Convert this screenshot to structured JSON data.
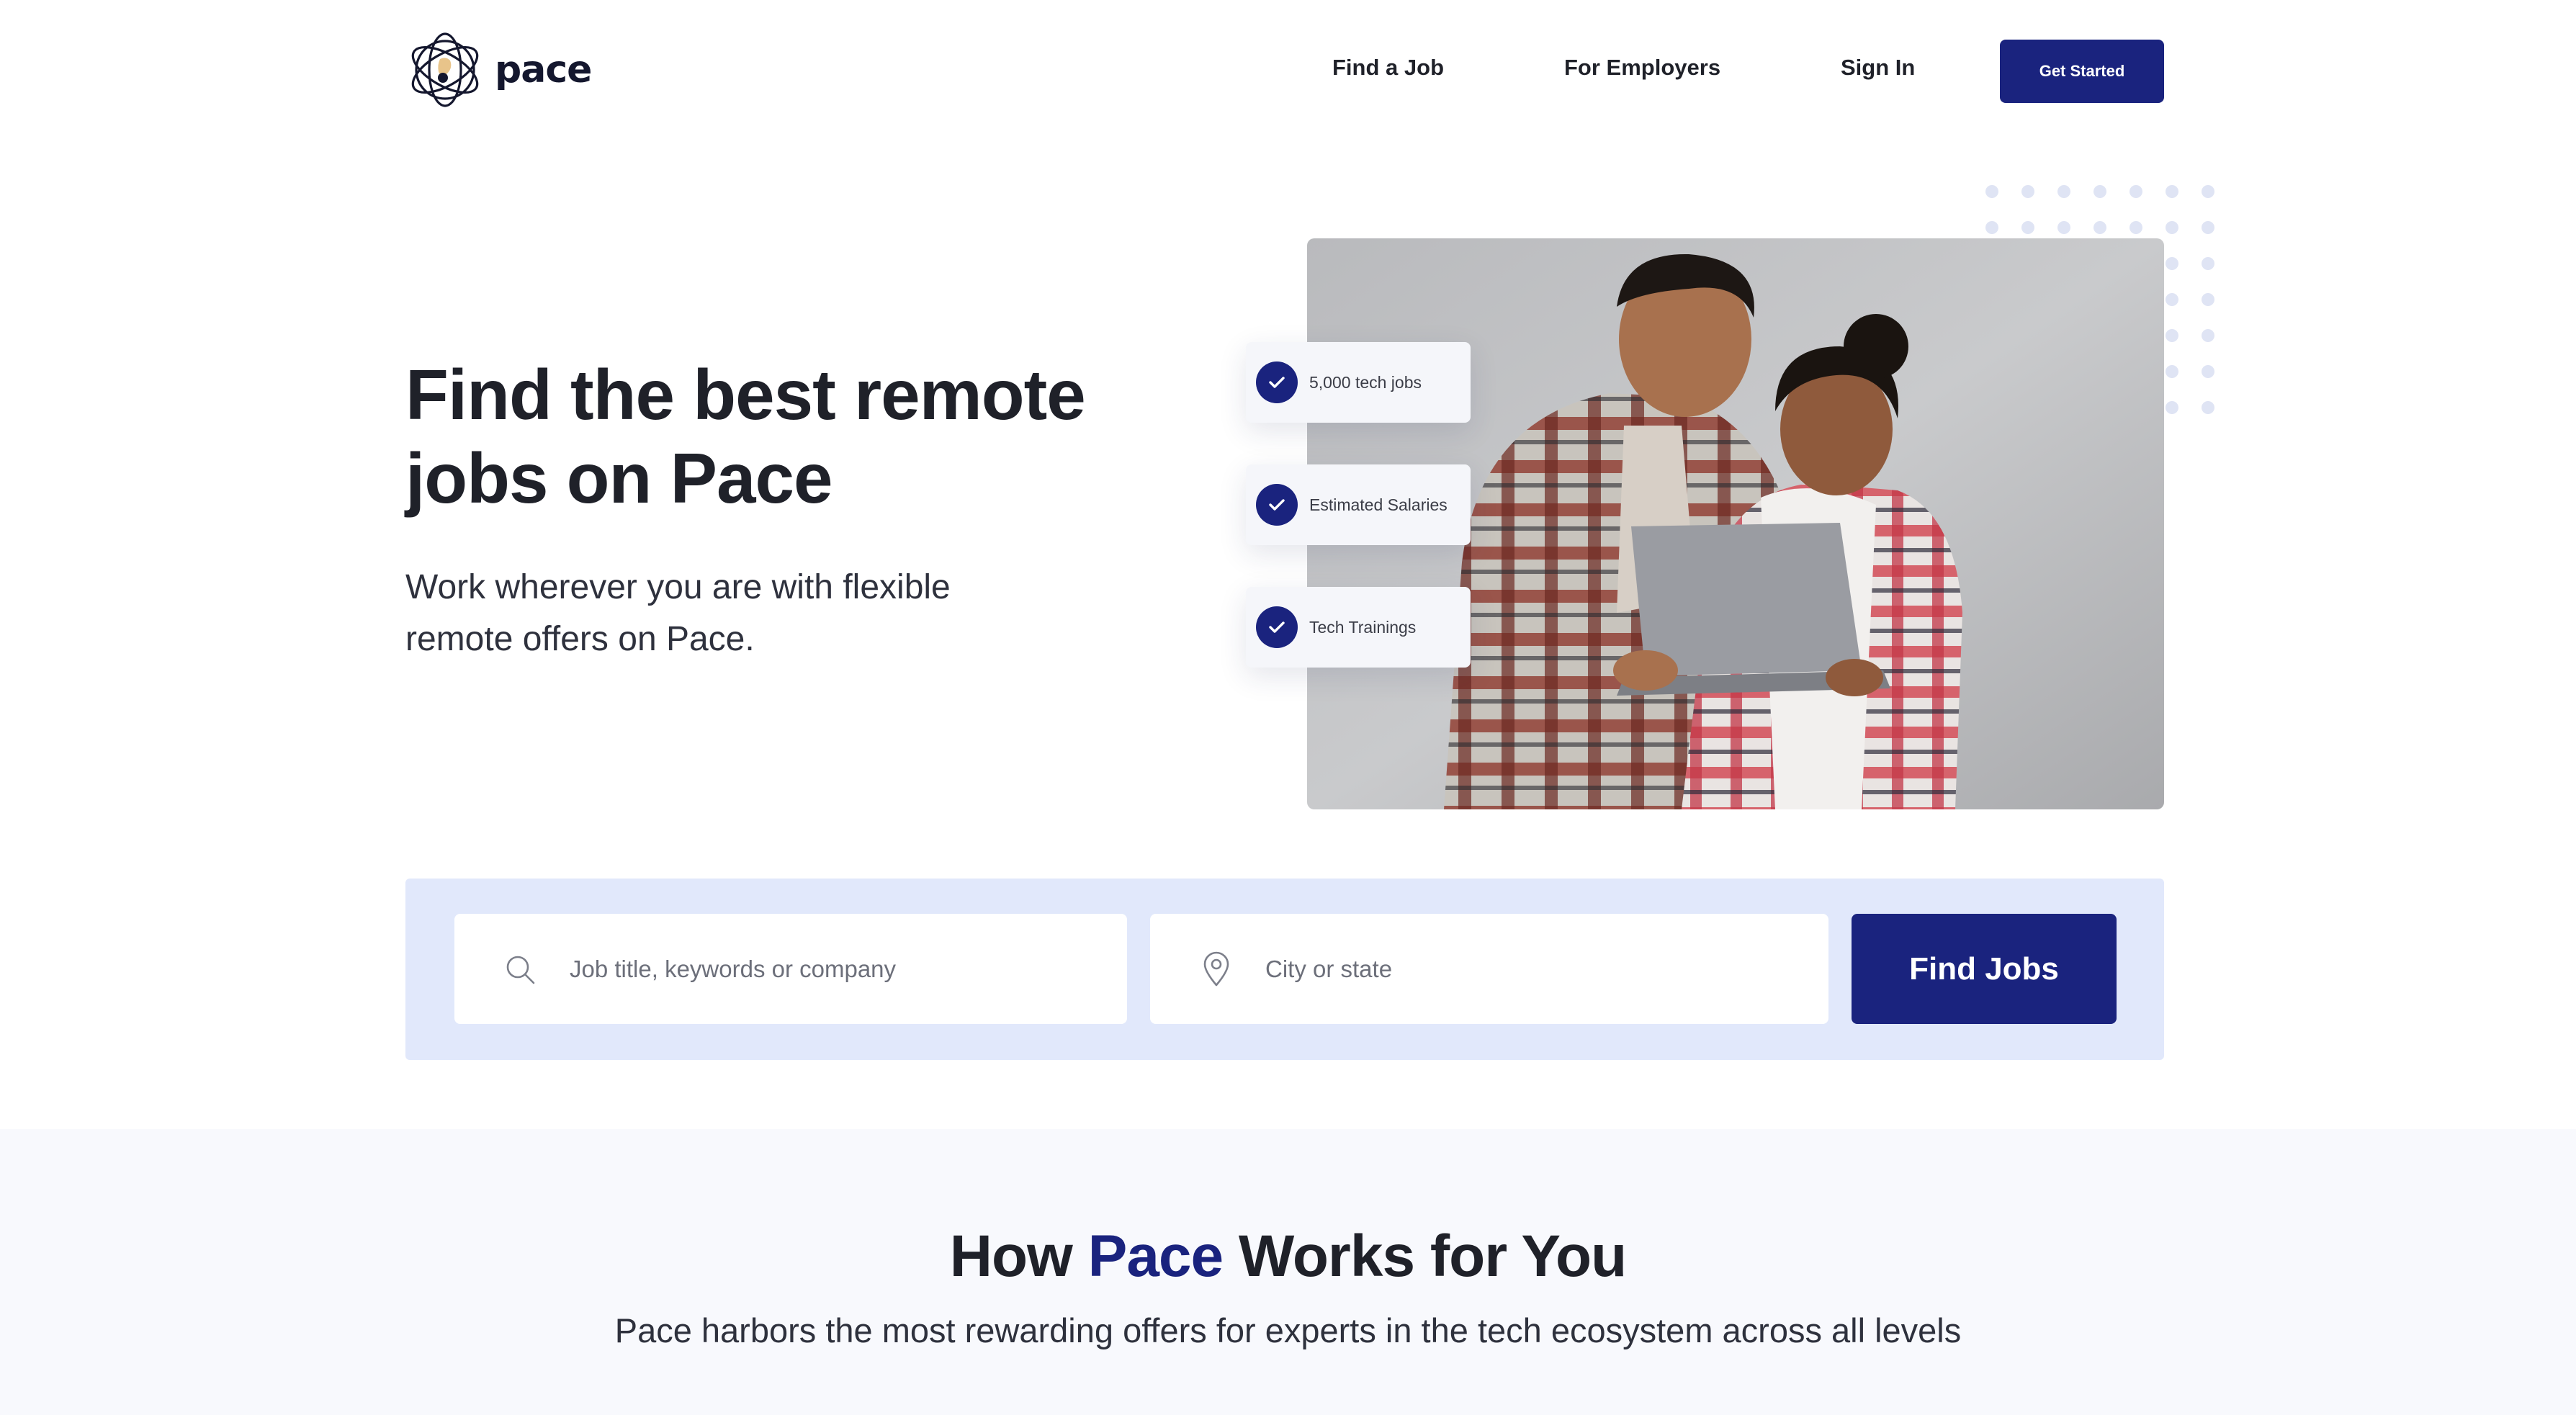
{
  "brand": {
    "name": "pace",
    "logo_icon": "globe-orbit-icon"
  },
  "nav": {
    "find_job": "Find a Job",
    "for_employers": "For Employers",
    "sign_in": "Sign In",
    "get_started": "Get Started"
  },
  "hero": {
    "title": "Find the best remote jobs on Pace",
    "subtitle": "Work wherever you are with flexible remote offers on Pace.",
    "features": [
      {
        "label": "5,000 tech jobs",
        "icon": "check-icon"
      },
      {
        "label": "Estimated Salaries",
        "icon": "check-icon"
      },
      {
        "label": "Tech Trainings",
        "icon": "check-icon"
      }
    ]
  },
  "search": {
    "keyword_value": "",
    "keyword_placeholder": "Job title, keywords or company",
    "keyword_icon": "search-icon",
    "location_value": "",
    "location_placeholder": "City or state",
    "location_icon": "location-pin-icon",
    "submit_label": "Find Jobs"
  },
  "how": {
    "title_before": "How ",
    "title_accent": "Pace",
    "title_after": " Works for You",
    "subtitle": "Pace harbors the most rewarding offers for experts in the tech ecosystem across all levels"
  },
  "colors": {
    "primary": "#1a237e",
    "search_panel_bg": "#e1e8fb",
    "section_bg": "#f8f9fd",
    "text": "#1f2129"
  }
}
